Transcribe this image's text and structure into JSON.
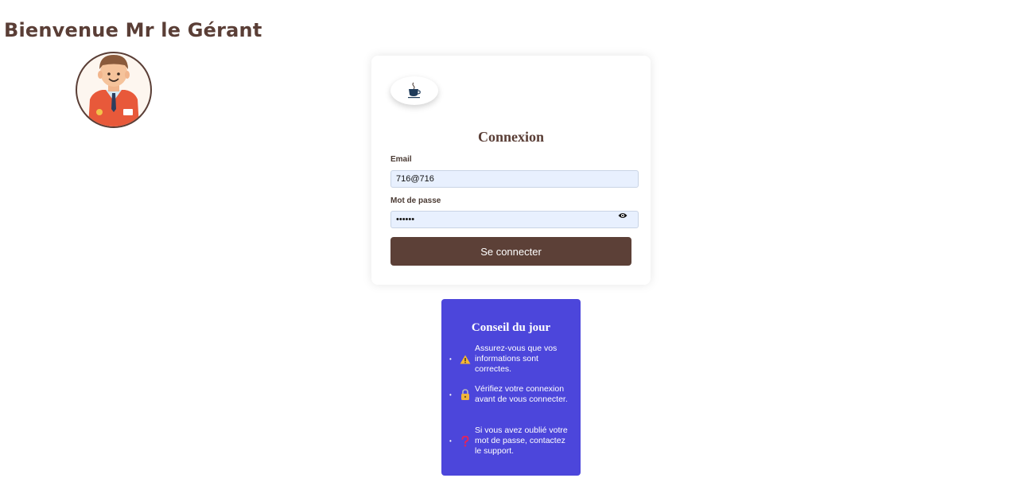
{
  "header": {
    "welcome_text": "Bienvenue Mr le Gérant"
  },
  "login": {
    "title": "Connexion",
    "email_label": "Email",
    "email_value": "716@716",
    "password_label": "Mot de passe",
    "password_value": "716716",
    "submit_label": "Se connecter"
  },
  "tips": {
    "title": "Conseil du jour",
    "items": [
      {
        "icon": "warning-icon",
        "text": "Assurez-vous que vos informations sont correctes."
      },
      {
        "icon": "lock-icon",
        "text": "Vérifiez votre connexion avant de vous connecter."
      },
      {
        "icon": "question-icon",
        "text": "Si vous avez oublié votre mot de passe, contactez le support."
      }
    ]
  },
  "colors": {
    "brand_brown": "#5c4037",
    "tips_background": "#4c46db",
    "input_background": "#e8f0fe"
  }
}
